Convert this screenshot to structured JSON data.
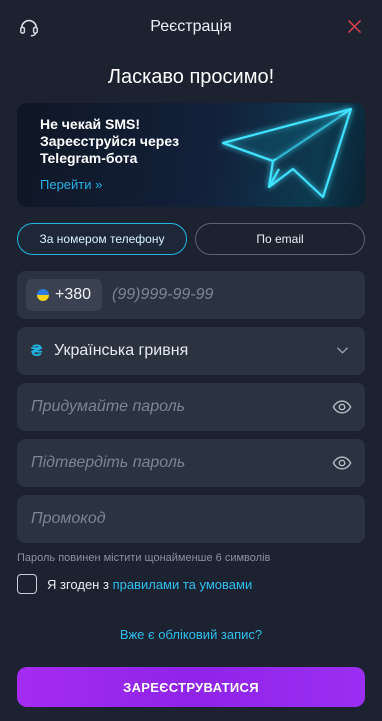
{
  "header": {
    "title": "Реєстрація",
    "left_icon": "headset-icon",
    "right_icon": "close-icon"
  },
  "welcome": "Ласкаво просимо!",
  "banner": {
    "text": "Не чекай SMS! Зареєструйся через Telegram-бота",
    "link": "Перейти »",
    "icon": "telegram-plane-icon"
  },
  "tabs": [
    {
      "label": "За номером телефону",
      "active": true
    },
    {
      "label": "По email",
      "active": false
    }
  ],
  "phone": {
    "country_code": "+380",
    "flag": "ukraine-flag-icon",
    "placeholder": "(99)999-99-99"
  },
  "currency": {
    "symbol": "₴",
    "label": "Українська гривня"
  },
  "password": {
    "placeholder": "Придумайте пароль"
  },
  "confirm_password": {
    "placeholder": "Підтвердіть пароль"
  },
  "promo": {
    "placeholder": "Промокод"
  },
  "hint": "Пароль повинен містити щонайменше 6 символів",
  "agree": {
    "prefix": "Я згоден з",
    "link": "правилами та умовами",
    "checked": false
  },
  "login_link": "Вже є обліковий запис?",
  "submit_label": "ЗАРЕЄСТРУВАТИСЯ",
  "colors": {
    "background": "#1c2230",
    "field": "#2b3240",
    "accent": "#22b7e4",
    "button_start": "#a52cf0",
    "button_end": "#8f24e8"
  }
}
